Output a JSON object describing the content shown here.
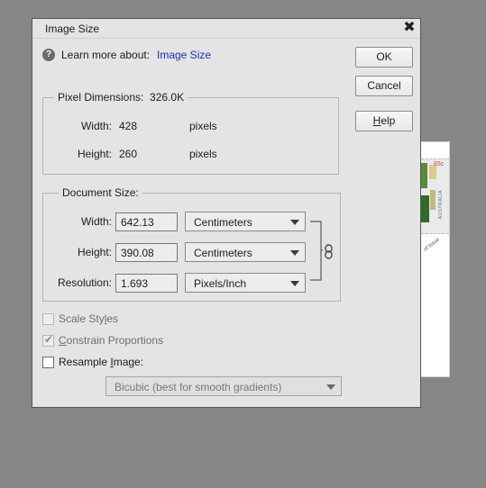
{
  "dialog": {
    "title": "Image Size",
    "close_glyph": "✖"
  },
  "learn": {
    "text": "Learn more about:",
    "link": "Image Size",
    "icon": "help-icon",
    "icon_glyph": "?"
  },
  "pixel_dimensions": {
    "legend": "Pixel Dimensions:",
    "size": "326.0K",
    "width_label": "Width:",
    "width_value": "428",
    "width_unit": "pixels",
    "height_label": "Height:",
    "height_value": "260",
    "height_unit": "pixels"
  },
  "document_size": {
    "legend": "Document Size:",
    "width_label": "Width:",
    "width_value": "642.13",
    "width_unit": "Centimeters",
    "height_label": "Height:",
    "height_value": "390.08",
    "height_unit": "Centimeters",
    "resolution_label": "Resolution:",
    "resolution_value": "1.693",
    "resolution_unit": "Pixels/Inch",
    "link_icon": "chain-link-icon"
  },
  "buttons": {
    "ok": "OK",
    "cancel": "Cancel",
    "help_mnemonic": "H",
    "help_rest": "elp"
  },
  "options": {
    "scale_styles_pre": "Scale Sty",
    "scale_styles_mn": "l",
    "scale_styles_post": "es",
    "scale_styles_checked": false,
    "scale_styles_enabled": false,
    "constrain_mn": "C",
    "constrain_post": "onstrain Proportions",
    "constrain_checked": true,
    "constrain_enabled": false,
    "resample_pre": "Resample ",
    "resample_mn": "I",
    "resample_post": "mage:",
    "resample_checked": false,
    "resample_method": "Bicubic (best for smooth gradients)"
  },
  "background_doc": {
    "stamp_price": "65c",
    "stamp_country": "AUSTRALIA",
    "issue_text": "of issue"
  },
  "colors": {
    "desktop": "#868686",
    "dialog_bg": "#e4e4e4",
    "link": "#1a33b4"
  }
}
